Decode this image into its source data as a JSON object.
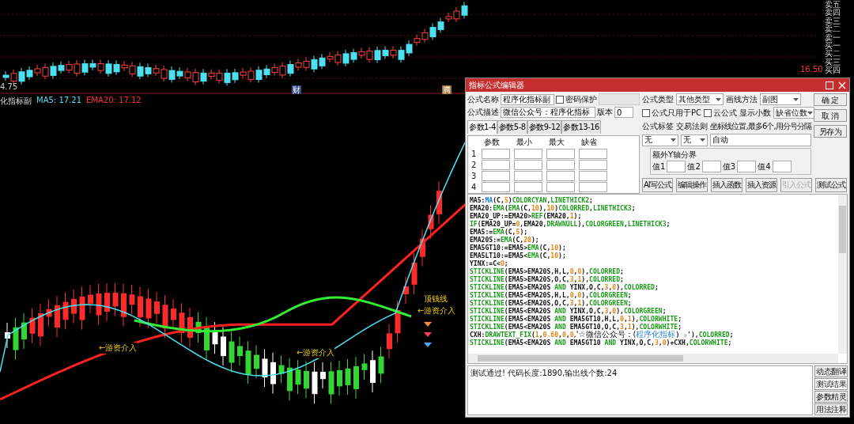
{
  "chart": {
    "price_label": "4.75",
    "finance_marker": "财",
    "news_marker": "腾",
    "indicator_name": "化指标副",
    "ma5_label": "MA5: 17.21",
    "ema20_label": "EMA20: 17.12",
    "annotations": [
      {
        "text": "←游资介入"
      },
      {
        "text": "←游资介入"
      },
      {
        "text": "←游资介入"
      },
      {
        "text": "顶钱线"
      }
    ]
  },
  "order_book": {
    "price_label": "16.50",
    "levels": [
      "卖五",
      "卖四",
      "卖三",
      "卖二",
      "卖一",
      "买一",
      "买二",
      "买三",
      "买四"
    ]
  },
  "dialog": {
    "title": "指标公式编辑器",
    "name_label": "公式名称",
    "name_value": "程序化指标副",
    "password": {
      "label": "密码保护",
      "checked": false
    },
    "desc_label": "公式描述",
    "desc_value": "微信公众号：程序化指标",
    "version_label": "版本",
    "version_value": "0",
    "tabs": [
      {
        "label": "参数1-4",
        "selected": true
      },
      {
        "label": "参数5-8",
        "selected": false
      },
      {
        "label": "参数9-12",
        "selected": false
      },
      {
        "label": "参数13-16",
        "selected": false
      }
    ],
    "param_columns": [
      "参数",
      "最小",
      "最大",
      "缺省"
    ],
    "param_rows": [
      "1",
      "2",
      "3",
      "4"
    ],
    "type_label": "公式类型",
    "type_value": "其他类型",
    "draw_label": "画线方法",
    "draw_value": "副图",
    "pc_only": {
      "label": "公式只用于PC",
      "checked": false
    },
    "cloud": {
      "label": "云公式",
      "checked": false
    },
    "decimals_label": "显示小数",
    "decimals_value": "缺省位数",
    "tag_label": "公式标签",
    "rule_label": "交易法则",
    "axis_label": "坐标线位置,最多6个,用分号分隔",
    "tag_value": "无",
    "rule_value": "无",
    "axis_value": "自动",
    "yaxis_group": "额外Y轴分界",
    "yaxis_values": [
      "值1",
      "值2",
      "值3",
      "值4"
    ],
    "side_buttons": [
      {
        "label": "确 定"
      },
      {
        "label": "取 消"
      },
      {
        "label": "另存为"
      }
    ],
    "tool_buttons": [
      {
        "label": "AI写公式",
        "disabled": false
      },
      {
        "label": "编辑操作",
        "disabled": false
      },
      {
        "label": "插入函数",
        "disabled": false
      },
      {
        "label": "插入资源",
        "disabled": false
      },
      {
        "label": "引入公式",
        "disabled": true
      },
      {
        "label": "测试公式",
        "disabled": false
      }
    ],
    "code": [
      [
        {
          "kind": "var",
          "text": "MA5:"
        },
        {
          "kind": "call",
          "text": "MA"
        },
        {
          "kind": "var",
          "text": "(C,"
        },
        {
          "kind": "num",
          "text": "5"
        },
        {
          "kind": "var",
          "text": ")"
        },
        {
          "kind": "func",
          "text": "COLORCYAN"
        },
        {
          "kind": "var",
          "text": ","
        },
        {
          "kind": "func",
          "text": "LINETHICK2"
        },
        {
          "kind": "var",
          "text": ";"
        }
      ],
      [
        {
          "kind": "var",
          "text": "EMA20:"
        },
        {
          "kind": "func",
          "text": "EMA"
        },
        {
          "kind": "var",
          "text": "("
        },
        {
          "kind": "func",
          "text": "EMA"
        },
        {
          "kind": "var",
          "text": "(C,"
        },
        {
          "kind": "num",
          "text": "10"
        },
        {
          "kind": "var",
          "text": "),"
        },
        {
          "kind": "num",
          "text": "10"
        },
        {
          "kind": "var",
          "text": ")"
        },
        {
          "kind": "func",
          "text": "COLORRED"
        },
        {
          "kind": "var",
          "text": ","
        },
        {
          "kind": "func",
          "text": "LINETHICK3"
        },
        {
          "kind": "var",
          "text": ";"
        }
      ],
      [
        {
          "kind": "var",
          "text": "EMA20_UP:=EMA20>"
        },
        {
          "kind": "func",
          "text": "REF"
        },
        {
          "kind": "var",
          "text": "(EMA20,"
        },
        {
          "kind": "num",
          "text": "1"
        },
        {
          "kind": "var",
          "text": ");"
        }
      ],
      [
        {
          "kind": "func",
          "text": "IF"
        },
        {
          "kind": "var",
          "text": "(EMA20_UP="
        },
        {
          "kind": "num",
          "text": "0"
        },
        {
          "kind": "var",
          "text": ",EMA20,"
        },
        {
          "kind": "func",
          "text": "DRAWNULL"
        },
        {
          "kind": "var",
          "text": "),"
        },
        {
          "kind": "func",
          "text": "COLORGREEN"
        },
        {
          "kind": "var",
          "text": ","
        },
        {
          "kind": "func",
          "text": "LINETHICK3"
        },
        {
          "kind": "var",
          "text": ";"
        }
      ],
      [
        {
          "kind": "var",
          "text": "EMA5:="
        },
        {
          "kind": "func",
          "text": "EMA"
        },
        {
          "kind": "var",
          "text": "(C,"
        },
        {
          "kind": "num",
          "text": "5"
        },
        {
          "kind": "var",
          "text": ");"
        }
      ],
      [
        {
          "kind": "var",
          "text": "EMA20S:="
        },
        {
          "kind": "func",
          "text": "EMA"
        },
        {
          "kind": "var",
          "text": "(C,"
        },
        {
          "kind": "num",
          "text": "20"
        },
        {
          "kind": "var",
          "text": ");"
        }
      ],
      [
        {
          "kind": "var",
          "text": "EMA5GT10:=EMA5>"
        },
        {
          "kind": "func",
          "text": "EMA"
        },
        {
          "kind": "var",
          "text": "(C,"
        },
        {
          "kind": "num",
          "text": "10"
        },
        {
          "kind": "var",
          "text": ");"
        }
      ],
      [
        {
          "kind": "var",
          "text": "EMA5LT10:=EMA5<"
        },
        {
          "kind": "func",
          "text": "EMA"
        },
        {
          "kind": "var",
          "text": "(C,"
        },
        {
          "kind": "num",
          "text": "10"
        },
        {
          "kind": "var",
          "text": ");"
        }
      ],
      [
        {
          "kind": "var",
          "text": "YINX:=C<"
        },
        {
          "kind": "num",
          "text": "O"
        },
        {
          "kind": "var",
          "text": ";"
        }
      ],
      [
        {
          "kind": "func",
          "text": "STICKLINE"
        },
        {
          "kind": "var",
          "text": "(EMA5>EMA20S,H,L,"
        },
        {
          "kind": "num",
          "text": "0"
        },
        {
          "kind": "var",
          "text": ","
        },
        {
          "kind": "num",
          "text": "0"
        },
        {
          "kind": "var",
          "text": "),"
        },
        {
          "kind": "func",
          "text": "COLORRED"
        },
        {
          "kind": "var",
          "text": ";"
        }
      ],
      [
        {
          "kind": "func",
          "text": "STICKLINE"
        },
        {
          "kind": "var",
          "text": "(EMA5>EMA20S,O,C,"
        },
        {
          "kind": "num",
          "text": "3"
        },
        {
          "kind": "var",
          "text": ","
        },
        {
          "kind": "num",
          "text": "1"
        },
        {
          "kind": "var",
          "text": "),"
        },
        {
          "kind": "func",
          "text": "COLORRED"
        },
        {
          "kind": "var",
          "text": ";"
        }
      ],
      [
        {
          "kind": "func",
          "text": "STICKLINE"
        },
        {
          "kind": "var",
          "text": "(EMA5>EMA20S "
        },
        {
          "kind": "func",
          "text": "AND"
        },
        {
          "kind": "var",
          "text": " YINX,O,C,"
        },
        {
          "kind": "num",
          "text": "3"
        },
        {
          "kind": "var",
          "text": ","
        },
        {
          "kind": "num",
          "text": "0"
        },
        {
          "kind": "var",
          "text": "),"
        },
        {
          "kind": "func",
          "text": "COLORRED"
        },
        {
          "kind": "var",
          "text": ";"
        }
      ],
      [
        {
          "kind": "func",
          "text": "STICKLINE"
        },
        {
          "kind": "var",
          "text": "(EMA5<EMA20S,H,L,"
        },
        {
          "kind": "num",
          "text": "0"
        },
        {
          "kind": "var",
          "text": ","
        },
        {
          "kind": "num",
          "text": "0"
        },
        {
          "kind": "var",
          "text": "),"
        },
        {
          "kind": "func",
          "text": "COLORGREEN"
        },
        {
          "kind": "var",
          "text": ";"
        }
      ],
      [
        {
          "kind": "func",
          "text": "STICKLINE"
        },
        {
          "kind": "var",
          "text": "(EMA5<EMA20S,O,C,"
        },
        {
          "kind": "num",
          "text": "3"
        },
        {
          "kind": "var",
          "text": ","
        },
        {
          "kind": "num",
          "text": "1"
        },
        {
          "kind": "var",
          "text": "),"
        },
        {
          "kind": "func",
          "text": "COLORGREEN"
        },
        {
          "kind": "var",
          "text": ";"
        }
      ],
      [
        {
          "kind": "func",
          "text": "STICKLINE"
        },
        {
          "kind": "var",
          "text": "(EMA5<EMA20S "
        },
        {
          "kind": "func",
          "text": "AND"
        },
        {
          "kind": "var",
          "text": " YINX,O,C,"
        },
        {
          "kind": "num",
          "text": "3"
        },
        {
          "kind": "var",
          "text": ","
        },
        {
          "kind": "num",
          "text": "0"
        },
        {
          "kind": "var",
          "text": "),"
        },
        {
          "kind": "func",
          "text": "COLORGREEN"
        },
        {
          "kind": "var",
          "text": ";"
        }
      ],
      [
        {
          "kind": "func",
          "text": "STICKLINE"
        },
        {
          "kind": "var",
          "text": "(EMA5<EMA20S "
        },
        {
          "kind": "func",
          "text": "AND"
        },
        {
          "kind": "var",
          "text": " EMA5GT10,H,L,"
        },
        {
          "kind": "num",
          "text": "0"
        },
        {
          "kind": "var",
          "text": ","
        },
        {
          "kind": "num",
          "text": "1"
        },
        {
          "kind": "var",
          "text": "),"
        },
        {
          "kind": "func",
          "text": "COLORWHITE"
        },
        {
          "kind": "var",
          "text": ";"
        }
      ],
      [
        {
          "kind": "func",
          "text": "STICKLINE"
        },
        {
          "kind": "var",
          "text": "(EMA5<EMA20S "
        },
        {
          "kind": "func",
          "text": "AND"
        },
        {
          "kind": "var",
          "text": " EMA5GT10,O,C,"
        },
        {
          "kind": "num",
          "text": "3"
        },
        {
          "kind": "var",
          "text": ","
        },
        {
          "kind": "num",
          "text": "1"
        },
        {
          "kind": "var",
          "text": "),"
        },
        {
          "kind": "func",
          "text": "COLORWHITE"
        },
        {
          "kind": "var",
          "text": ";"
        }
      ],
      [
        {
          "kind": "var",
          "text": "CXH:"
        },
        {
          "kind": "func",
          "text": "DRAWTEXT_FIX"
        },
        {
          "kind": "var",
          "text": "("
        },
        {
          "kind": "num",
          "text": "1"
        },
        {
          "kind": "var",
          "text": ","
        },
        {
          "kind": "num",
          "text": "0.60"
        },
        {
          "kind": "var",
          "text": ","
        },
        {
          "kind": "num",
          "text": "0"
        },
        {
          "kind": "var",
          "text": ","
        },
        {
          "kind": "num",
          "text": "0"
        },
        {
          "kind": "str",
          "text": ",'☆微信公众号：("
        },
        {
          "kind": "link",
          "text": "程序化指标"
        },
        {
          "kind": "var",
          "text": ") ☆'),"
        },
        {
          "kind": "func",
          "text": "COLORRED"
        },
        {
          "kind": "var",
          "text": ";"
        }
      ],
      [
        {
          "kind": "func",
          "text": "STICKLINE"
        },
        {
          "kind": "var",
          "text": "(EMA5<EMA20S "
        },
        {
          "kind": "func",
          "text": "AND"
        },
        {
          "kind": "var",
          "text": " EMA5GT10 "
        },
        {
          "kind": "func",
          "text": "AND"
        },
        {
          "kind": "var",
          "text": " YINX,O,C,"
        },
        {
          "kind": "num",
          "text": "3"
        },
        {
          "kind": "var",
          "text": ","
        },
        {
          "kind": "num",
          "text": "0"
        },
        {
          "kind": "var",
          "text": ")+CXH,"
        },
        {
          "kind": "func",
          "text": "COLORWHITE"
        },
        {
          "kind": "var",
          "text": ";"
        }
      ]
    ],
    "output": "测试通过! 代码长度:1890,输出线个数:24",
    "output_buttons": [
      {
        "label": "动态翻译",
        "selected": false
      },
      {
        "label": "测试结果",
        "selected": true
      },
      {
        "label": "参数精灵",
        "selected": false
      },
      {
        "label": "用法注释",
        "selected": false
      }
    ]
  }
}
